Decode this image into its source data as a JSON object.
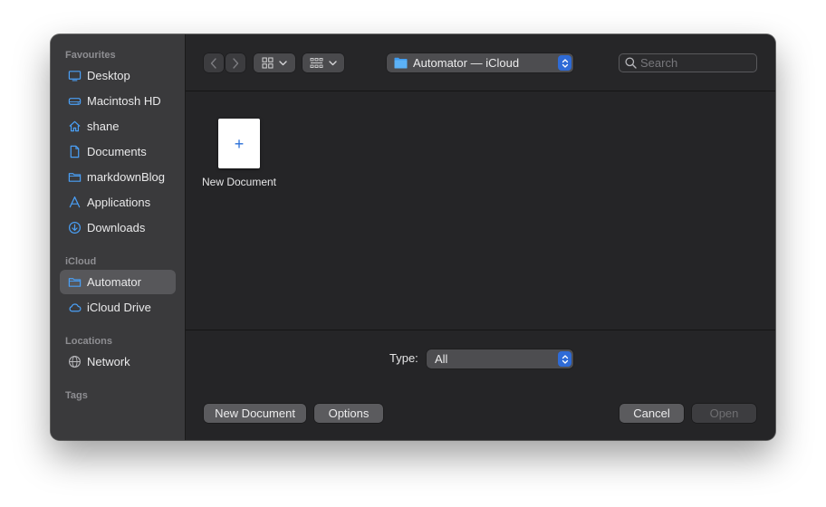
{
  "sidebar": {
    "sections": [
      {
        "title": "Favourites",
        "items": [
          {
            "label": "Desktop",
            "icon": "desktop-icon"
          },
          {
            "label": "Macintosh HD",
            "icon": "hard-drive-icon"
          },
          {
            "label": "shane",
            "icon": "home-icon"
          },
          {
            "label": "Documents",
            "icon": "document-icon"
          },
          {
            "label": "markdownBlog",
            "icon": "folder-icon"
          },
          {
            "label": "Applications",
            "icon": "applications-icon"
          },
          {
            "label": "Downloads",
            "icon": "download-icon"
          }
        ]
      },
      {
        "title": "iCloud",
        "items": [
          {
            "label": "Automator",
            "icon": "folder-icon",
            "selected": true
          },
          {
            "label": "iCloud Drive",
            "icon": "cloud-icon"
          }
        ]
      },
      {
        "title": "Locations",
        "items": [
          {
            "label": "Network",
            "icon": "globe-icon"
          }
        ]
      },
      {
        "title": "Tags",
        "items": []
      }
    ]
  },
  "toolbar": {
    "location": "Automator — iCloud",
    "search_placeholder": "Search"
  },
  "files": [
    {
      "name": "New Document",
      "thumb_symbol": "+"
    }
  ],
  "type_filter": {
    "label": "Type:",
    "value": "All"
  },
  "footer": {
    "new_document_label": "New Document",
    "options_label": "Options",
    "cancel_label": "Cancel",
    "open_label": "Open"
  },
  "colors": {
    "accent": "#2f6bd6",
    "sidebar_icon": "#4a9ff5"
  }
}
